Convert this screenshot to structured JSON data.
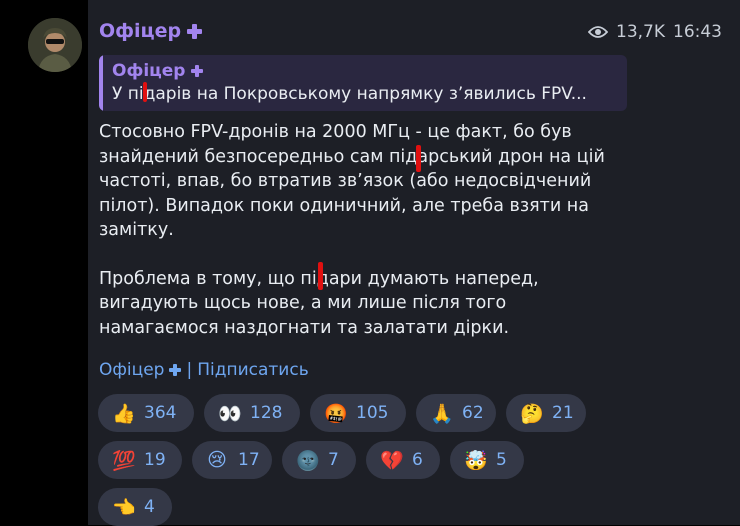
{
  "post": {
    "author": "Офіцер",
    "views": "13,7K",
    "time": "16:43",
    "reply": {
      "author": "Офіцер",
      "text": "У підарів на Покровському напрямку з’явились FPV..."
    },
    "paragraph1": "Стосовно FPV-дронів на 2000 МГц - це факт, бо був знайдений безпосередньо сам підарський дрон на цій частоті, впав, бо втратив зв’язок (або недосвідчений пілот). Випадок поки одиничний, але треба взяти на замітку.",
    "paragraph2": "Проблема в тому, що підари думають наперед, вигадують щось нове, а ми лише після того намагаємося наздогнати та залатати дірки.",
    "signature_name": "Офіцер",
    "signature_separator": "|",
    "signature_link": "Підписатись"
  },
  "reactions": [
    {
      "icon": "thumbs-up-icon",
      "emoji": "👍",
      "count": "364"
    },
    {
      "icon": "eyes-icon",
      "emoji": "👀",
      "count": "128"
    },
    {
      "icon": "angry-face-icon",
      "emoji": "🤬",
      "count": "105"
    },
    {
      "icon": "pray-icon",
      "emoji": "🙏",
      "count": "62"
    },
    {
      "icon": "thinking-face-icon",
      "emoji": "🤔",
      "count": "21"
    },
    {
      "icon": "hundred-icon",
      "emoji": "💯",
      "count": "19"
    },
    {
      "icon": "crying-face-icon",
      "emoji": "😢",
      "count": "17"
    },
    {
      "icon": "new-moon-face-icon",
      "emoji": "🌚",
      "count": "7"
    },
    {
      "icon": "broken-heart-icon",
      "emoji": "💔",
      "count": "6"
    },
    {
      "icon": "exploding-head-icon",
      "emoji": "🤯",
      "count": "5"
    },
    {
      "icon": "pointing-hand-icon",
      "emoji": "👈",
      "count": "4"
    }
  ],
  "colors": {
    "background": "#000000",
    "bubble": "#1d1f26",
    "accent_purple": "#a284ee",
    "link_blue": "#6ea6f0",
    "reaction_pill": "#343847"
  }
}
